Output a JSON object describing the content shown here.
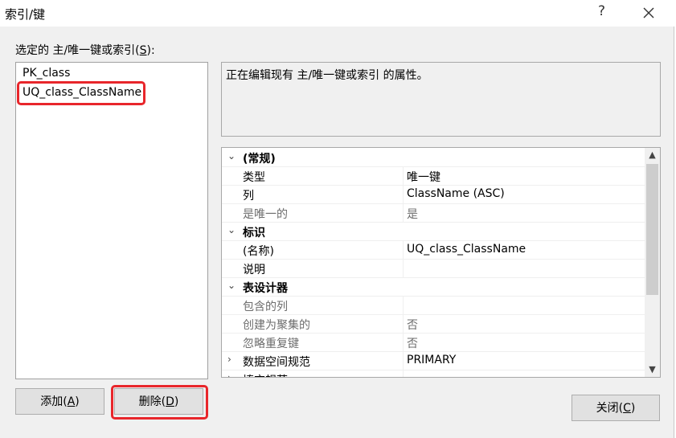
{
  "window": {
    "title": "索引/键",
    "help": "?"
  },
  "selector": {
    "label": "选定的 主/唯一键或索引(",
    "accel": "S",
    "suffix": "):"
  },
  "indexes": [
    {
      "name": "PK_class"
    },
    {
      "name": "UQ_class_ClassName"
    }
  ],
  "description": "正在编辑现有 主/唯一键或索引 的属性。",
  "properties": [
    {
      "kind": "category",
      "expander": "⌄",
      "name": "(常规)",
      "value": ""
    },
    {
      "kind": "prop",
      "name": "类型",
      "value": "唯一键"
    },
    {
      "kind": "prop",
      "name": "列",
      "value": "ClassName (ASC)"
    },
    {
      "kind": "dim",
      "name": "是唯一的",
      "value": "是"
    },
    {
      "kind": "category",
      "expander": "⌄",
      "name": "标识",
      "value": ""
    },
    {
      "kind": "prop",
      "name": "(名称)",
      "value": "UQ_class_ClassName"
    },
    {
      "kind": "prop",
      "name": "说明",
      "value": ""
    },
    {
      "kind": "category",
      "expander": "⌄",
      "name": "表设计器",
      "value": ""
    },
    {
      "kind": "dim",
      "name": "包含的列",
      "value": ""
    },
    {
      "kind": "dim",
      "name": "创建为聚集的",
      "value": "否"
    },
    {
      "kind": "dim",
      "name": "忽略重复键",
      "value": "否"
    },
    {
      "kind": "prop",
      "expander": "›",
      "name": "数据空间规范",
      "value": "PRIMARY"
    },
    {
      "kind": "prop",
      "expander": "›",
      "name": "填充规范",
      "value": ""
    }
  ],
  "buttons": {
    "add": {
      "label": "添加(",
      "accel": "A",
      "suffix": ")"
    },
    "delete": {
      "label": "删除(",
      "accel": "D",
      "suffix": ")"
    },
    "close": {
      "label": "关闭(",
      "accel": "C",
      "suffix": ")"
    }
  },
  "colors": {
    "highlight": "#e8262b",
    "dialog_bg": "#f0f0f0"
  }
}
